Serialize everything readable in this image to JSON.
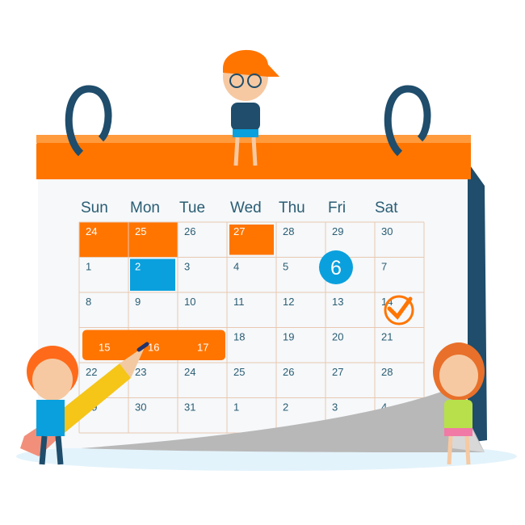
{
  "calendar": {
    "weekdays": [
      "Sun",
      "Mon",
      "Tue",
      "Wed",
      "Thu",
      "Fri",
      "Sat"
    ],
    "weeks": [
      [
        "24",
        "25",
        "26",
        "27",
        "28",
        "29",
        "30"
      ],
      [
        "1",
        "2",
        "3",
        "4",
        "5",
        "",
        "7"
      ],
      [
        "8",
        "9",
        "10",
        "11",
        "12",
        "13",
        "14"
      ],
      [
        "15",
        "16",
        "17",
        "18",
        "19",
        "20",
        "21"
      ],
      [
        "22",
        "23",
        "24",
        "25",
        "26",
        "27",
        "28"
      ],
      [
        "29",
        "30",
        "31",
        "1",
        "2",
        "3",
        "4"
      ]
    ],
    "highlighted_day": "6",
    "colors": {
      "accent": "#ff7500",
      "blue": "#0aa0dd",
      "navy": "#1f4d6b",
      "text": "#2a5d73",
      "grid": "#e8c8b0"
    }
  }
}
